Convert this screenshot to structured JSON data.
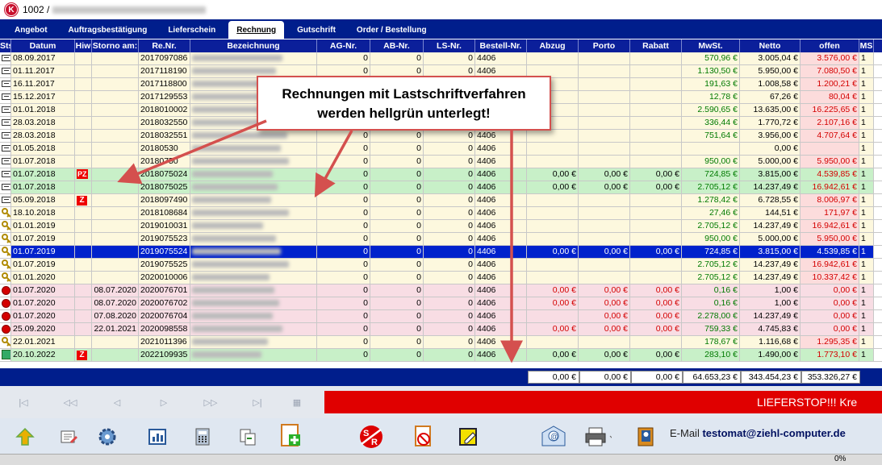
{
  "window": {
    "doc_number": "1002 /"
  },
  "tabs": [
    "Angebot",
    "Auftragsbestätigung",
    "Lieferschein",
    "Rechnung",
    "Gutschrift",
    "Order / Bestellung"
  ],
  "active_tab": "Rechnung",
  "columns": [
    "Sts",
    "Datum",
    "Hiw",
    "Storno am:",
    "Re.Nr.",
    "Bezeichnung",
    "AG-Nr.",
    "AB-Nr.",
    "LS-Nr.",
    "Bestell-Nr.",
    "Abzug",
    "Porto",
    "Rabatt",
    "MwSt.",
    "Netto",
    "offen",
    "MS"
  ],
  "rows": [
    {
      "sts": "envelope",
      "datum": "08.09.2017",
      "hiw": "",
      "storno": "",
      "renr": "2017097086",
      "ag": "0",
      "ab": "0",
      "ls": "0",
      "bestell": "4406",
      "abzug": "",
      "porto": "",
      "rabatt": "",
      "mwst": "570,96 €",
      "netto": "3.005,04 €",
      "offen": "3.576,00 €",
      "ms": "1",
      "style": "base"
    },
    {
      "sts": "envelope",
      "datum": "01.11.2017",
      "hiw": "",
      "storno": "",
      "renr": "2017118190",
      "ag": "0",
      "ab": "0",
      "ls": "0",
      "bestell": "4406",
      "abzug": "",
      "porto": "",
      "rabatt": "",
      "mwst": "1.130,50 €",
      "netto": "5.950,00 €",
      "offen": "7.080,50 €",
      "ms": "1",
      "style": "base"
    },
    {
      "sts": "envelope",
      "datum": "16.11.2017",
      "hiw": "",
      "storno": "",
      "renr": "2017118800",
      "ag": "",
      "ab": "",
      "ls": "",
      "bestell": "",
      "abzug": "",
      "porto": "",
      "rabatt": "",
      "mwst": "191,63 €",
      "netto": "1.008,58 €",
      "offen": "1.200,21 €",
      "ms": "1",
      "style": "base"
    },
    {
      "sts": "envelope",
      "datum": "15.12.2017",
      "hiw": "",
      "storno": "",
      "renr": "2017129553",
      "ag": "",
      "ab": "",
      "ls": "",
      "bestell": "",
      "abzug": "",
      "porto": "",
      "rabatt": "",
      "mwst": "12,78 €",
      "netto": "67,26 €",
      "offen": "80,04 €",
      "ms": "1",
      "style": "base"
    },
    {
      "sts": "envelope",
      "datum": "01.01.2018",
      "hiw": "",
      "storno": "",
      "renr": "2018010002",
      "ag": "",
      "ab": "",
      "ls": "",
      "bestell": "",
      "abzug": "",
      "porto": "",
      "rabatt": "",
      "mwst": "2.590,65 €",
      "netto": "13.635,00 €",
      "offen": "16.225,65 €",
      "ms": "1",
      "style": "base"
    },
    {
      "sts": "envelope",
      "datum": "28.03.2018",
      "hiw": "",
      "storno": "",
      "renr": "2018032550",
      "ag": "",
      "ab": "",
      "ls": "",
      "bestell": "",
      "abzug": "",
      "porto": "",
      "rabatt": "",
      "mwst": "336,44 €",
      "netto": "1.770,72 €",
      "offen": "2.107,16 €",
      "ms": "1",
      "style": "base"
    },
    {
      "sts": "envelope",
      "datum": "28.03.2018",
      "hiw": "",
      "storno": "",
      "renr": "2018032551",
      "ag": "0",
      "ab": "0",
      "ls": "0",
      "bestell": "4406",
      "abzug": "",
      "porto": "",
      "rabatt": "",
      "mwst": "751,64 €",
      "netto": "3.956,00 €",
      "offen": "4.707,64 €",
      "ms": "1",
      "style": "base"
    },
    {
      "sts": "envelope",
      "datum": "01.05.2018",
      "hiw": "",
      "storno": "",
      "renr": "20180530",
      "ag": "0",
      "ab": "0",
      "ls": "0",
      "bestell": "4406",
      "abzug": "",
      "porto": "",
      "rabatt": "",
      "mwst": "",
      "netto": "0,00 €",
      "offen": "",
      "ms": "1",
      "style": "base"
    },
    {
      "sts": "envelope",
      "datum": "01.07.2018",
      "hiw": "",
      "storno": "",
      "renr": "20180750",
      "ag": "0",
      "ab": "0",
      "ls": "0",
      "bestell": "4406",
      "abzug": "",
      "porto": "",
      "rabatt": "",
      "mwst": "950,00 €",
      "netto": "5.000,00 €",
      "offen": "5.950,00 €",
      "ms": "1",
      "style": "base"
    },
    {
      "sts": "envelope",
      "datum": "01.07.2018",
      "hiw": "PZ",
      "storno": "",
      "renr": "2018075024",
      "ag": "0",
      "ab": "0",
      "ls": "0",
      "bestell": "4406",
      "abzug": "0,00 €",
      "porto": "0,00 €",
      "rabatt": "0,00 €",
      "mwst": "724,85 €",
      "netto": "3.815,00 €",
      "offen": "4.539,85 €",
      "ms": "1",
      "style": "green"
    },
    {
      "sts": "envelope",
      "datum": "01.07.2018",
      "hiw": "",
      "storno": "",
      "renr": "2018075025",
      "ag": "0",
      "ab": "0",
      "ls": "0",
      "bestell": "4406",
      "abzug": "0,00 €",
      "porto": "0,00 €",
      "rabatt": "0,00 €",
      "mwst": "2.705,12 €",
      "netto": "14.237,49 €",
      "offen": "16.942,61 €",
      "ms": "1",
      "style": "green"
    },
    {
      "sts": "envelope",
      "datum": "05.09.2018",
      "hiw": "Z",
      "storno": "",
      "renr": "2018097490",
      "ag": "0",
      "ab": "0",
      "ls": "0",
      "bestell": "4406",
      "abzug": "",
      "porto": "",
      "rabatt": "",
      "mwst": "1.278,42 €",
      "netto": "6.728,55 €",
      "offen": "8.006,97 €",
      "ms": "1",
      "style": "base"
    },
    {
      "sts": "key",
      "datum": "18.10.2018",
      "hiw": "",
      "storno": "",
      "renr": "2018108684",
      "ag": "0",
      "ab": "0",
      "ls": "0",
      "bestell": "4406",
      "abzug": "",
      "porto": "",
      "rabatt": "",
      "mwst": "27,46 €",
      "netto": "144,51 €",
      "offen": "171,97 €",
      "ms": "1",
      "style": "base"
    },
    {
      "sts": "key",
      "datum": "01.01.2019",
      "hiw": "",
      "storno": "",
      "renr": "2019010031",
      "ag": "0",
      "ab": "0",
      "ls": "0",
      "bestell": "4406",
      "abzug": "",
      "porto": "",
      "rabatt": "",
      "mwst": "2.705,12 €",
      "netto": "14.237,49 €",
      "offen": "16.942,61 €",
      "ms": "1",
      "style": "base"
    },
    {
      "sts": "key",
      "datum": "01.07.2019",
      "hiw": "",
      "storno": "",
      "renr": "2019075523",
      "ag": "0",
      "ab": "0",
      "ls": "0",
      "bestell": "4406",
      "abzug": "",
      "porto": "",
      "rabatt": "",
      "mwst": "950,00 €",
      "netto": "5.000,00 €",
      "offen": "5.950,00 €",
      "ms": "1",
      "style": "base"
    },
    {
      "sts": "key",
      "datum": "01.07.2019",
      "hiw": "",
      "storno": "",
      "renr": "2019075524",
      "ag": "0",
      "ab": "0",
      "ls": "0",
      "bestell": "4406",
      "abzug": "0,00 €",
      "porto": "0,00 €",
      "rabatt": "0,00 €",
      "mwst": "724,85 €",
      "netto": "3.815,00 €",
      "offen": "4.539,85 €",
      "ms": "1",
      "style": "sel"
    },
    {
      "sts": "key",
      "datum": "01.07.2019",
      "hiw": "",
      "storno": "",
      "renr": "2019075525",
      "ag": "0",
      "ab": "0",
      "ls": "0",
      "bestell": "4406",
      "abzug": "",
      "porto": "",
      "rabatt": "",
      "mwst": "2.705,12 €",
      "netto": "14.237,49 €",
      "offen": "16.942,61 €",
      "ms": "1",
      "style": "base"
    },
    {
      "sts": "key",
      "datum": "01.01.2020",
      "hiw": "",
      "storno": "",
      "renr": "2020010006",
      "ag": "0",
      "ab": "0",
      "ls": "0",
      "bestell": "4406",
      "abzug": "",
      "porto": "",
      "rabatt": "",
      "mwst": "2.705,12 €",
      "netto": "14.237,49 €",
      "offen": "10.337,42 €",
      "ms": "1",
      "style": "base"
    },
    {
      "sts": "stop",
      "datum": "01.07.2020",
      "hiw": "",
      "storno": "08.07.2020",
      "renr": "2020076701",
      "ag": "0",
      "ab": "0",
      "ls": "0",
      "bestell": "4406",
      "abzug": "0,00 €",
      "porto": "0,00 €",
      "rabatt": "0,00 €",
      "mwst": "0,16 €",
      "netto": "1,00 €",
      "offen": "0,00 €",
      "ms": "1",
      "style": "pink"
    },
    {
      "sts": "stop",
      "datum": "01.07.2020",
      "hiw": "",
      "storno": "08.07.2020",
      "renr": "2020076702",
      "ag": "0",
      "ab": "0",
      "ls": "0",
      "bestell": "4406",
      "abzug": "0,00 €",
      "porto": "0,00 €",
      "rabatt": "0,00 €",
      "mwst": "0,16 €",
      "netto": "1,00 €",
      "offen": "0,00 €",
      "ms": "1",
      "style": "pink"
    },
    {
      "sts": "stop",
      "datum": "01.07.2020",
      "hiw": "",
      "storno": "07.08.2020",
      "renr": "2020076704",
      "ag": "0",
      "ab": "0",
      "ls": "0",
      "bestell": "4406",
      "abzug": "",
      "porto": "0,00 €",
      "rabatt": "0,00 €",
      "mwst": "2.278,00 €",
      "netto": "14.237,49 €",
      "offen": "0,00 €",
      "ms": "1",
      "style": "pink"
    },
    {
      "sts": "stop",
      "datum": "25.09.2020",
      "hiw": "",
      "storno": "22.01.2021",
      "renr": "2020098558",
      "ag": "0",
      "ab": "0",
      "ls": "0",
      "bestell": "4406",
      "abzug": "0,00 €",
      "porto": "0,00 €",
      "rabatt": "0,00 €",
      "mwst": "759,33 €",
      "netto": "4.745,83 €",
      "offen": "0,00 €",
      "ms": "1",
      "style": "pink"
    },
    {
      "sts": "key",
      "datum": "22.01.2021",
      "hiw": "",
      "storno": "",
      "renr": "2021011396",
      "ag": "0",
      "ab": "0",
      "ls": "0",
      "bestell": "4406",
      "abzug": "",
      "porto": "",
      "rabatt": "",
      "mwst": "178,67 €",
      "netto": "1.116,68 €",
      "offen": "1.295,35 €",
      "ms": "1",
      "style": "base"
    },
    {
      "sts": "calendar",
      "datum": "20.10.2022",
      "hiw": "Z",
      "storno": "",
      "renr": "2022109935",
      "ag": "0",
      "ab": "0",
      "ls": "0",
      "bestell": "4406",
      "abzug": "0,00 €",
      "porto": "0,00 €",
      "rabatt": "0,00 €",
      "mwst": "283,10 €",
      "netto": "1.490,00 €",
      "offen": "1.773,10 €",
      "ms": "1",
      "style": "green"
    }
  ],
  "totals": {
    "abzug": "0,00 €",
    "porto": "0,00 €",
    "rabatt": "0,00 €",
    "mwst": "64.653,23 €",
    "netto": "343.454,23 €",
    "offen": "353.326,27 €"
  },
  "nav": [
    "|◁",
    "◁◁",
    "◁",
    "▷",
    "▷▷",
    "▷|"
  ],
  "lieferstop_text": "LIEFERSTOP!!!  Kre",
  "callout": {
    "line1": "Rechnungen mit Lastschriftverfahren",
    "line2": "werden hellgrün unterlegt!"
  },
  "email": {
    "label": "E-Mail",
    "address": "testomat@ziehl-computer.de"
  },
  "statusbar": {
    "percent": "0%"
  },
  "colors": {
    "header_blue": "#0b1f9a",
    "selection_blue": "#0022cc",
    "debit_green": "#c8f0c8",
    "storno_pink": "#f8dde4",
    "lieferstop_red": "#e00000"
  }
}
